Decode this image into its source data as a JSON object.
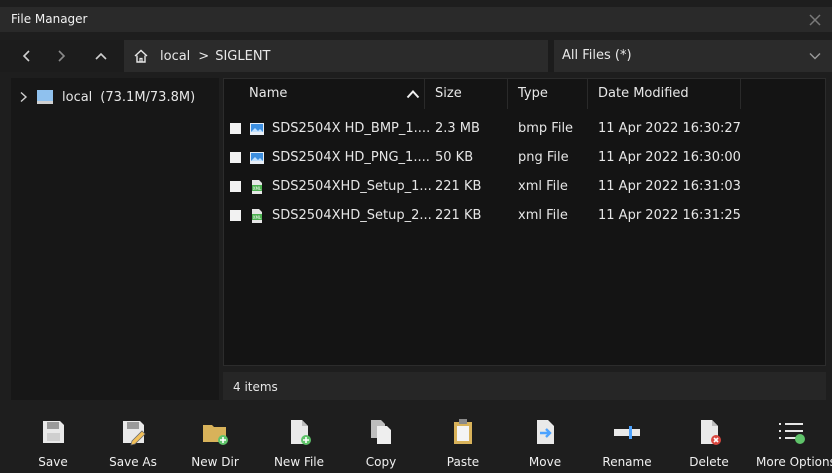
{
  "window": {
    "title": "File Manager"
  },
  "nav": {
    "path_root": "local",
    "path_separator": ">",
    "path_child": "SIGLENT"
  },
  "filter": {
    "selected": "All Files (*)"
  },
  "tree": {
    "label": "local",
    "usage": "(73.1M/73.8M)"
  },
  "table": {
    "columns": [
      "Name",
      "Size",
      "Type",
      "Date Modified"
    ],
    "rows": [
      {
        "name": "SDS2504X HD_BMP_1....",
        "size": "2.3 MB",
        "type": "bmp File",
        "date": "11 Apr 2022 16:30:27",
        "icon": "image-file-icon"
      },
      {
        "name": "SDS2504X HD_PNG_1....",
        "size": "50 KB",
        "type": "png File",
        "date": "11 Apr 2022 16:30:00",
        "icon": "image-file-icon"
      },
      {
        "name": "SDS2504XHD_Setup_1...",
        "size": "221 KB",
        "type": "xml File",
        "date": "11 Apr 2022 16:31:03",
        "icon": "xml-file-icon"
      },
      {
        "name": "SDS2504XHD_Setup_2...",
        "size": "221 KB",
        "type": "xml File",
        "date": "11 Apr 2022 16:31:25",
        "icon": "xml-file-icon"
      }
    ]
  },
  "status": {
    "count": "4 items"
  },
  "toolbar": {
    "save": "Save",
    "save_as": "Save As",
    "new_dir": "New Dir",
    "new_file": "New File",
    "copy": "Copy",
    "paste": "Paste",
    "move": "Move",
    "rename": "Rename",
    "delete": "Delete",
    "more": "More Options"
  },
  "colors": {
    "accent_blue": "#4da3ff",
    "add_green": "#5fc36a",
    "delete_red": "#d9473f",
    "folder_yellow": "#d8b25a"
  }
}
